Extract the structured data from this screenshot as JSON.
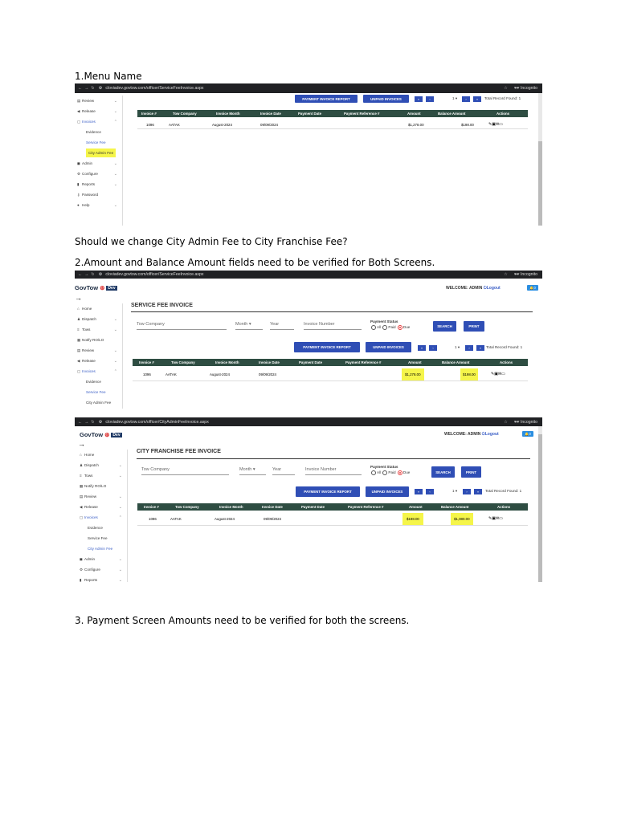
{
  "paragraphs": {
    "p1": "1.Menu Name",
    "p2": "Should we change City Admin Fee to City Franchise Fee?",
    "p3": "2.Amount and Balance Amount fields need to be verified for Both Screens.",
    "p4": "3. Payment Screen Amounts need to be verified for both the screens."
  },
  "shot1": {
    "url": "cloviadev.govtow.com/officer/ServiceFeeInvoice.aspx",
    "incognito": "Incognito",
    "menu": [
      "Review",
      "Release",
      "Invoices"
    ],
    "submenu": [
      "Evidence",
      "Service Fee",
      "City Admin Fee"
    ],
    "menu2": [
      "Admin",
      "Configure",
      "Reports",
      "Password",
      "Help"
    ],
    "btn_report": "PAYMENT INVOICE REPORT",
    "btn_unpaid": "UNPAID INVOICES",
    "page_sel": "1 ▾",
    "total": "Total Record Found: 1"
  },
  "table": {
    "headers": [
      "Invoice #",
      "Tow Company",
      "Invoice Month",
      "Invoice Date",
      "Payment Date",
      "Payment Reference #",
      "Amount",
      "Balance Amount",
      "Actions"
    ]
  },
  "row_s1": {
    "inv": "1096",
    "co": "AATAK",
    "month": "August-2024",
    "date": "09/09/2024",
    "amt": "$1,278.00",
    "bal": "$198.00"
  },
  "shot2": {
    "url": "cloviadev.govtow.com/officer/ServiceFeeInvoice.aspx",
    "incognito": "Incognito",
    "logo": "GovTow",
    "dev": "Dev",
    "welcome": "WELCOME: ADMIN",
    "logout": "Logout",
    "badge": "0",
    "arrow": "→",
    "menu": [
      "Home",
      "Dispatch",
      "Tows",
      "Notify RO/LO",
      "Review",
      "Release",
      "Invoices"
    ],
    "submenu": [
      "Evidence",
      "Service Fee",
      "City Admin Fee"
    ],
    "title": "SERVICE FEE INVOICE",
    "f_company": "Tow Company",
    "f_month": "Month",
    "f_year": "Year",
    "f_invnum": "Invoice Number",
    "pay_status": "Payment Status",
    "r_all": "All",
    "r_paid": "Paid",
    "r_due": "Due",
    "search": "SEARCH",
    "print": "PRINT",
    "btn_report": "PAYMENT INVOICE REPORT",
    "btn_unpaid": "UNPAID INVOICES",
    "page_sel": "1 ▾",
    "total": "Total Record Found: 1"
  },
  "row_s2": {
    "inv": "1096",
    "co": "AATAK",
    "month": "August-2024",
    "date": "09/09/2024",
    "amt": "$1,278.00",
    "bal": "$198.00"
  },
  "shot3": {
    "url": "cloviadev.govtow.com/officer/CityAdminFeeInvoice.aspx",
    "incognito": "Incognito",
    "logo": "GovTow",
    "dev": "Dev",
    "welcome": "WELCOME: ADMIN",
    "logout": "Logout",
    "badge": "0",
    "arrow": "→",
    "menu": [
      "Home",
      "Dispatch",
      "Tows",
      "Notify RO/LO",
      "Review",
      "Release",
      "Invoices"
    ],
    "submenu": [
      "Evidence",
      "Service Fee",
      "City Admin Fee"
    ],
    "menu2": [
      "Admin",
      "Configure",
      "Reports"
    ],
    "title": "CITY FRANCHISE FEE INVOICE",
    "f_company": "Tow Company",
    "f_month": "Month",
    "f_year": "Year",
    "f_invnum": "Invoice Number",
    "pay_status": "Payment Status",
    "r_all": "All",
    "r_paid": "Paid",
    "r_due": "Due",
    "search": "SEARCH",
    "print": "PRINT",
    "btn_report": "PAYMENT INVOICE REPORT",
    "btn_unpaid": "UNPAID INVOICES",
    "page_sel": "1 ▾",
    "total": "Total Record Found: 1"
  },
  "row_s3": {
    "inv": "1096",
    "co": "AATAK",
    "month": "August-2024",
    "date": "09/09/2024",
    "amt": "$198.00",
    "bal": "$1,080.00"
  },
  "colors": {
    "accent": "#2f4eb5",
    "table_header": "#2e4d42",
    "highlight": "#f5f54a"
  }
}
